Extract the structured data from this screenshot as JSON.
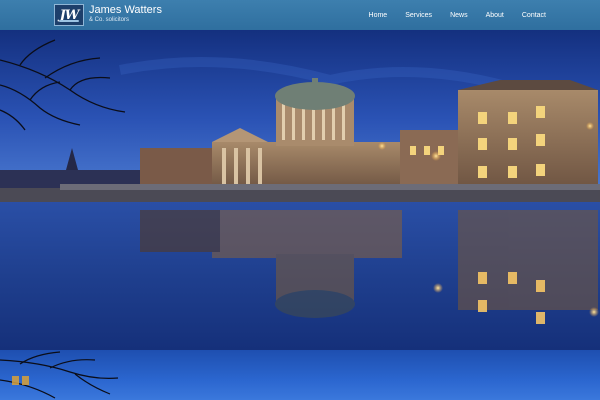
{
  "brand": {
    "logo_icon": "jw-monogram-logo",
    "logo_text": "JW",
    "name": "James Watters",
    "tagline": "& Co. solicitors"
  },
  "nav": {
    "items": [
      {
        "label": "Home"
      },
      {
        "label": "Services"
      },
      {
        "label": "News"
      },
      {
        "label": "About"
      },
      {
        "label": "Contact"
      }
    ]
  },
  "hero": {
    "image": "four-courts-dublin-night-photo"
  },
  "colors": {
    "header": "#3578a8",
    "accent": "#d8a13a",
    "sky": "#1d3f9e"
  }
}
